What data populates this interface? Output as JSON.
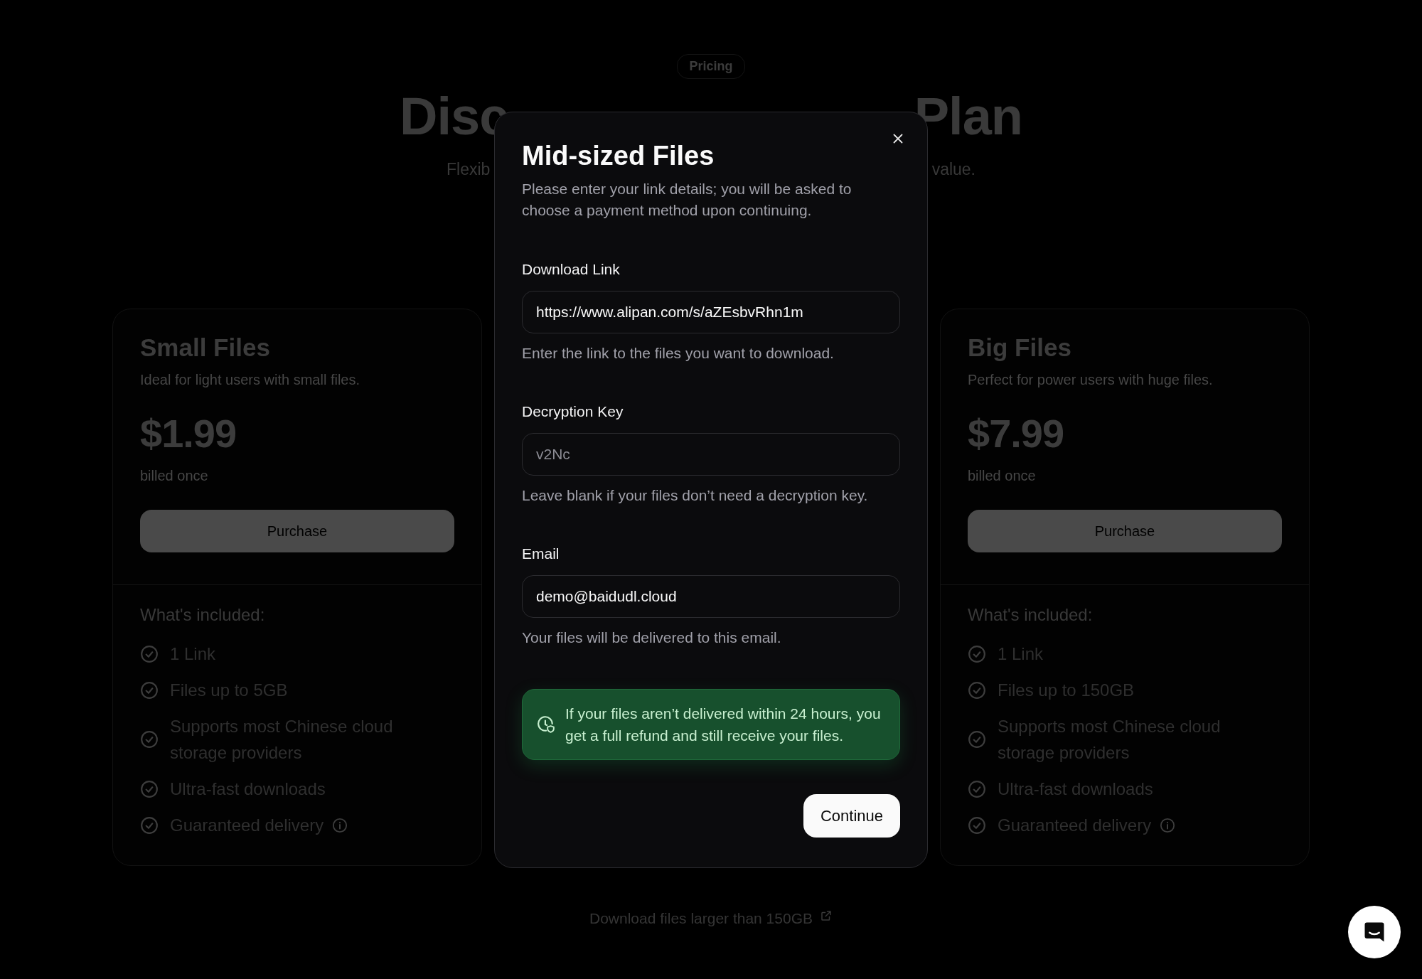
{
  "badge": "Pricing",
  "heading_visible": [
    "Disc",
    "Plan"
  ],
  "subtitle_visible": [
    "Flexib",
    "value."
  ],
  "plans": [
    {
      "title": "Small Files",
      "description": "Ideal for light users with small files.",
      "price": "$1.99",
      "billing": "billed once",
      "button": "Purchase",
      "features_heading": "What's included:",
      "features": [
        {
          "text": "1 Link",
          "info": false
        },
        {
          "text": "Files up to 5GB",
          "info": false
        },
        {
          "text": "Supports most Chinese cloud storage providers",
          "info": false
        },
        {
          "text": "Ultra-fast downloads",
          "info": false
        },
        {
          "text": "Guaranteed delivery",
          "info": true
        }
      ]
    },
    {
      "title": "Big Files",
      "description": "Perfect for power users with huge files.",
      "price": "$7.99",
      "billing": "billed once",
      "button": "Purchase",
      "features_heading": "What's included:",
      "features": [
        {
          "text": "1 Link",
          "info": false
        },
        {
          "text": "Files up to 150GB",
          "info": false
        },
        {
          "text": "Supports most Chinese cloud storage providers",
          "info": false
        },
        {
          "text": "Ultra-fast downloads",
          "info": false
        },
        {
          "text": "Guaranteed delivery",
          "info": true
        }
      ]
    }
  ],
  "footer_link": "Download files larger than 150GB",
  "modal": {
    "title": "Mid-sized Files",
    "description": "Please enter your link details; you will be asked to choose a payment method upon continuing.",
    "fields": [
      {
        "label": "Download Link",
        "value": "https://www.alipan.com/s/aZEsbvRhn1m",
        "help": "Enter the link to the files you want to download."
      },
      {
        "label": "Decryption Key",
        "placeholder": "v2Nc",
        "help": "Leave blank if your files don’t need a decryption key."
      },
      {
        "label": "Email",
        "value": "demo@baidudl.cloud",
        "help": "Your files will be delivered to this email."
      }
    ],
    "notice": "If your files aren’t delivered within 24 hours, you get a full refund and still receive your files.",
    "button": "Continue"
  }
}
